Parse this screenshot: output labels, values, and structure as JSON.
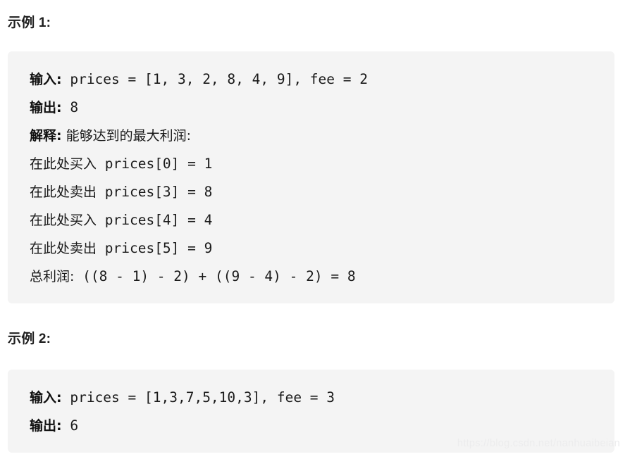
{
  "page": {
    "background_color": "#ffffff",
    "block_background_color": "#f4f4f4",
    "text_color": "#1a1a1a"
  },
  "examples": [
    {
      "heading": "示例 1:",
      "lines": [
        {
          "label": "输入:",
          "code": " prices = [1, 3, 2, 8, 4, 9], fee = 2",
          "cn": ""
        },
        {
          "label": "输出:",
          "code": " 8",
          "cn": ""
        },
        {
          "label": "解释:",
          "code": "",
          "cn": " 能够达到的最大利润:"
        },
        {
          "label": "",
          "cn": "在此处买入",
          "code": " prices[0] = 1"
        },
        {
          "label": "",
          "cn": "在此处卖出",
          "code": " prices[3] = 8"
        },
        {
          "label": "",
          "cn": "在此处买入",
          "code": " prices[4] = 4"
        },
        {
          "label": "",
          "cn": "在此处卖出",
          "code": " prices[5] = 9"
        },
        {
          "label": "",
          "cn": "总利润:",
          "code": " ((8 - 1) - 2) + ((9 - 4) - 2) = 8"
        }
      ]
    },
    {
      "heading": "示例 2:",
      "lines": [
        {
          "label": "输入:",
          "code": " prices = [1,3,7,5,10,3], fee = 3",
          "cn": ""
        },
        {
          "label": "输出:",
          "code": " 6",
          "cn": ""
        }
      ]
    }
  ],
  "watermark": {
    "text": "https://blog.csdn.net/nanhuaibeian"
  }
}
